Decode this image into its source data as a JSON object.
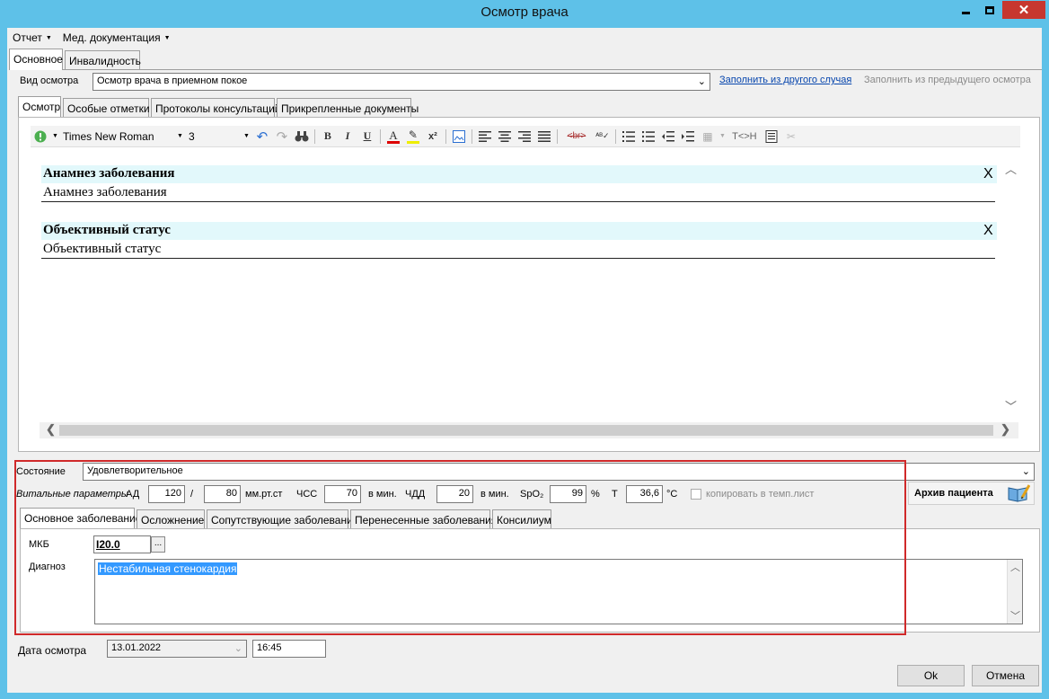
{
  "window": {
    "title": "Осмотр врача"
  },
  "menu": {
    "report": "Отчет",
    "med_docs": "Мед. документация"
  },
  "top_tabs": [
    "Основное",
    "Инвалидность"
  ],
  "exam_type": {
    "label": "Вид осмотра",
    "value": "Осмотр врача в приемном покое",
    "fill_other_link": "Заполнить из другого случая",
    "fill_prev_link": "Заполнить из предыдущего осмотра"
  },
  "sub_tabs": [
    "Осмотр",
    "Особые отметки",
    "Протоколы консультаций",
    "Прикрепленные документы"
  ],
  "toolbar": {
    "font_name": "Times New Roman",
    "font_size": "3",
    "bold": "B",
    "italic": "I",
    "underline": "U",
    "text_swap": "T<>H"
  },
  "editor": {
    "sections": [
      {
        "title": "Анамнез заболевания",
        "body": "Анамнез заболевания",
        "remove": "X"
      },
      {
        "title": "Объективный статус",
        "body": "Объективный статус",
        "remove": "X"
      }
    ]
  },
  "state": {
    "label": "Состояние",
    "value": "Удовлетворительное"
  },
  "vitals": {
    "label": "Витальные параметры",
    "bp_label": "АД",
    "bp_sys": "120",
    "bp_sep": "/",
    "bp_dia": "80",
    "bp_unit": "мм.рт.ст",
    "hr_label": "ЧСС",
    "hr": "70",
    "hr_unit": "в мин.",
    "rr_label": "ЧДД",
    "rr": "20",
    "rr_unit": "в мин.",
    "spo2_label": "SpO₂",
    "spo2": "99",
    "spo2_unit": "%",
    "temp_label": "T",
    "temp": "36,6",
    "temp_unit": "°C",
    "copy_label": "копировать в темп.лист"
  },
  "archive_button": "Архив пациента",
  "diag_tabs": [
    "Основное заболевание",
    "Осложнение",
    "Сопутствующие заболевания",
    "Перенесенные заболевания",
    "Консилиум"
  ],
  "diagnosis": {
    "mkb_label": "МКБ",
    "mkb_value": "I20.0",
    "mkb_btn": "...",
    "label": "Диагноз",
    "value": "Нестабильная стенокардия"
  },
  "exam_date": {
    "label": "Дата осмотра",
    "date": "13.01.2022",
    "time": "16:45"
  },
  "buttons": {
    "ok": "Ok",
    "cancel": "Отмена"
  }
}
